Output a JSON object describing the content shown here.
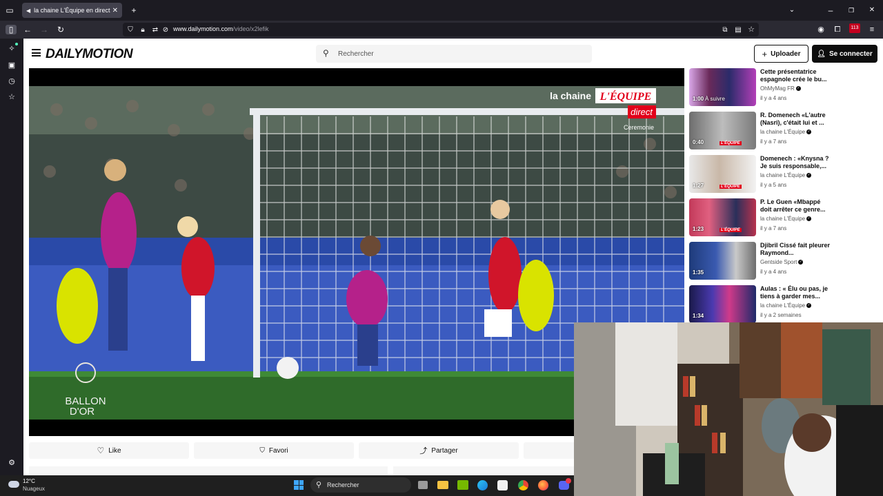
{
  "browser": {
    "tab_title": "la chaine L'Équipe en direct",
    "url_domain": "www.dailymotion.com",
    "url_path": "/video/x2lefik",
    "notification_count": "113"
  },
  "site": {
    "logo": "DAILYMOTION",
    "search_placeholder": "Rechercher",
    "upload_label": "Uploader",
    "login_label": "Se connecter"
  },
  "video": {
    "channel_overlay": "la chaine",
    "brand_overlay": "L'ÉQUIPE",
    "live_overlay": "direct",
    "program_overlay": "Ceremonie",
    "ballon_line1": "BALLON",
    "ballon_line2": "D'OR"
  },
  "actions": {
    "like": "Like",
    "favori": "Favori",
    "partager": "Partager"
  },
  "related": [
    {
      "title": "Cette présentatrice espagnole crée le bu...",
      "channel": "OhMyMag FR",
      "date": "il y a 4 ans",
      "duration": "1:00",
      "next_label": "À suivre"
    },
    {
      "title": "R. Domenech «L'autre (Nasri), c'était lui et ...",
      "channel": "la chaine L'Équipe",
      "date": "il y a 7 ans",
      "duration": "0:40",
      "next_label": ""
    },
    {
      "title": "Domenech : «Knysna ? Je suis responsable,...",
      "channel": "la chaine L'Équipe",
      "date": "il y a 5 ans",
      "duration": "1:27",
      "next_label": ""
    },
    {
      "title": "P. Le Guen «Mbappé doit arrêter ce genre...",
      "channel": "la chaine L'Équipe",
      "date": "il y a 7 ans",
      "duration": "1:23",
      "next_label": ""
    },
    {
      "title": "Djibril Cissé fait pleurer Raymond...",
      "channel": "Gentside Sport",
      "date": "il y a 4 ans",
      "duration": "1:35",
      "next_label": ""
    },
    {
      "title": "Aulas : « Élu ou pas, je tiens à garder mes...",
      "channel": "la chaine L'Équipe",
      "date": "il y a 2 semaines",
      "duration": "1:34",
      "next_label": ""
    }
  ],
  "taskbar": {
    "temperature": "12°C",
    "weather": "Nuageux",
    "search_label": "Rechercher"
  },
  "colors": {
    "equipe_red": "#e2001a",
    "pitch_green": "#2f6b2a",
    "barca_blue": "#2a3f8c",
    "arsenal_red": "#d0152a",
    "brand_black": "#0d0d0d"
  }
}
